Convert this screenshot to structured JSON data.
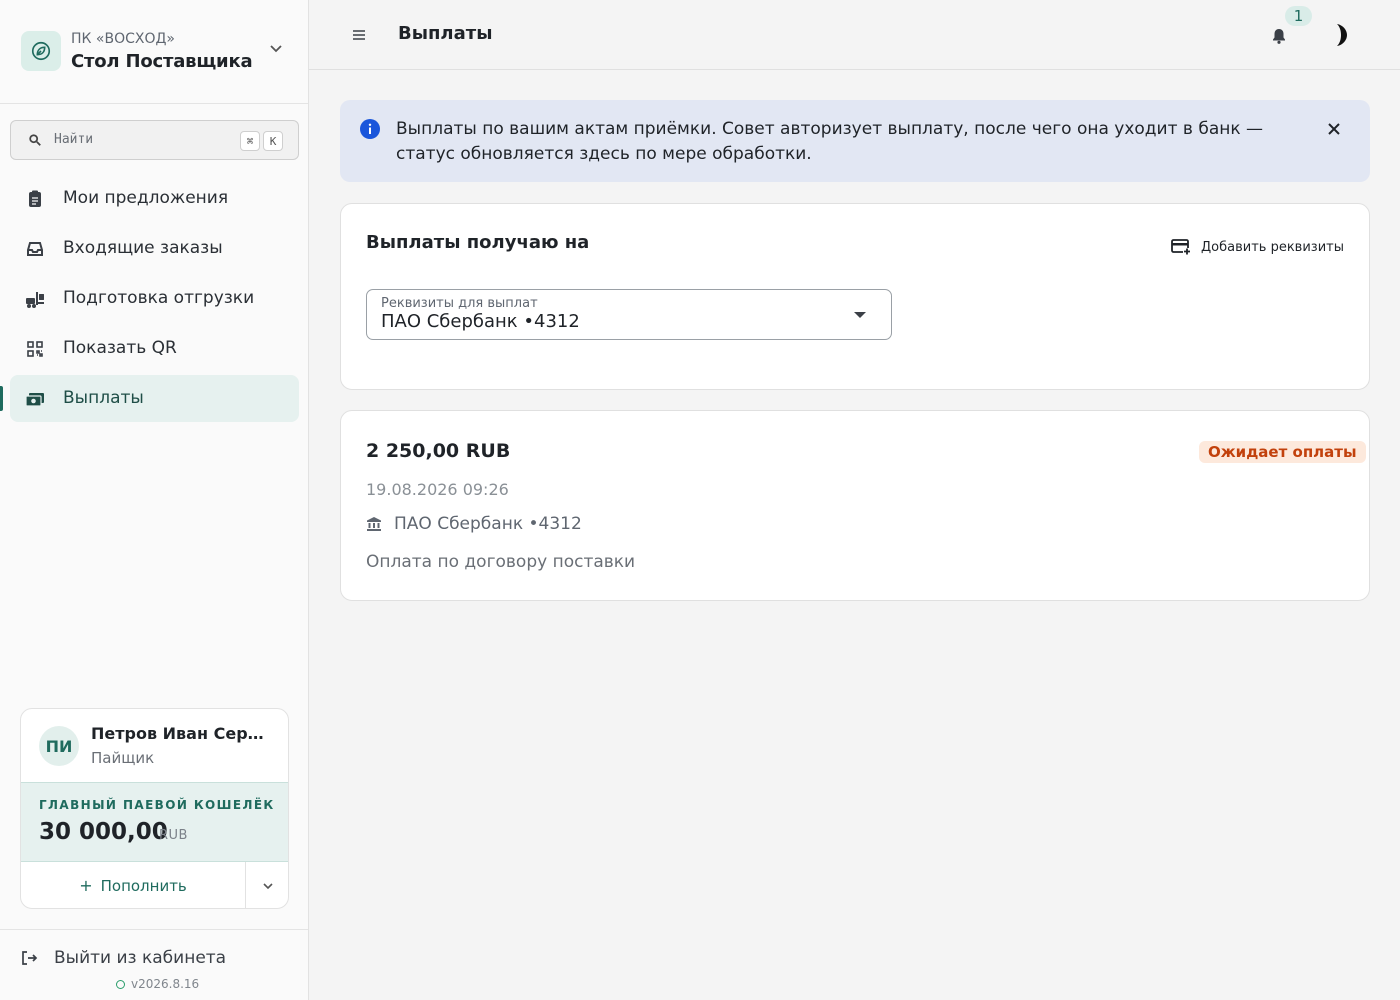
{
  "org": {
    "subtitle": "ПК «ВОСХОД»",
    "name": "Стол Поставщика",
    "logo_icon": "leaf-coin-icon"
  },
  "search": {
    "placeholder": "Найти",
    "shortcut_key1": "⌘",
    "shortcut_key2": "K"
  },
  "sidebar": {
    "items": [
      {
        "label": "Мои предложения",
        "icon": "clipboard-icon"
      },
      {
        "label": "Входящие заказы",
        "icon": "inbox-icon"
      },
      {
        "label": "Подготовка отгрузки",
        "icon": "forklift-icon"
      },
      {
        "label": "Показать QR",
        "icon": "qr-code-icon"
      },
      {
        "label": "Выплаты",
        "icon": "cash-icon",
        "active": true
      }
    ]
  },
  "user": {
    "initials": "ПИ",
    "name": "Петров Иван Сергеевич",
    "role": "Пайщик"
  },
  "wallet": {
    "title": "ГЛАВНЫЙ ПАЕВОЙ КОШЕЛЁК",
    "amount": "30 000,00",
    "currency": "RUB",
    "topup_label": "Пополнить"
  },
  "footer": {
    "logout_label": "Выйти из кабинета",
    "version": "v2026.8.16"
  },
  "topbar": {
    "title": "Выплаты",
    "notification_count": "1"
  },
  "info_banner": {
    "text": "Выплаты по вашим актам приёмки. Совет авторизует выплату, после чего она уходит в банк — статус обновляется здесь по мере обработки."
  },
  "payout_details": {
    "title": "Выплаты получаю на",
    "add_button_label": "Добавить реквизиты",
    "select_label": "Реквизиты для выплат",
    "select_value": "ПАО Сбербанк •4312"
  },
  "payment": {
    "amount": "2 250,00 RUB",
    "status": "Ожидает оплаты",
    "datetime": "19.08.2026 09:26",
    "bank": "ПАО Сбербанк •4312",
    "description": "Оплата по договору поставки"
  },
  "colors": {
    "accent": "#1f6b5e",
    "active_bg": "#e6f1ef",
    "info_bg": "#e2e7f3",
    "info_icon": "#1a56db",
    "status_text": "#c2410c",
    "status_bg": "#fde9dc"
  }
}
